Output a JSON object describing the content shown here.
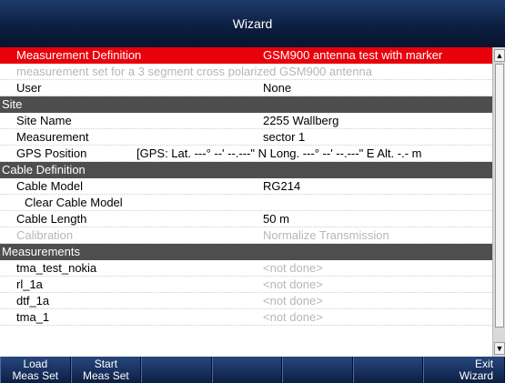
{
  "window": {
    "title": "Wizard"
  },
  "rows": {
    "measurement_definition": {
      "label": "Measurement Definition",
      "value": "GSM900 antenna test with marker"
    },
    "description": {
      "text": "measurement set for a 3 segment cross polarized GSM900 antenna"
    },
    "user": {
      "label": "User",
      "value": "None"
    },
    "site_header": {
      "label": "Site"
    },
    "site_name": {
      "label": "Site Name",
      "value": "2255 Wallberg"
    },
    "measurement": {
      "label": "Measurement",
      "value": "sector 1"
    },
    "gps_position": {
      "label": "GPS Position",
      "value": "[GPS: Lat.  ---° --' --.---\" N  Long.  ---° --' --.---\" E  Alt. -.- m"
    },
    "cable_header": {
      "label": "Cable Definition"
    },
    "cable_model": {
      "label": "Cable Model",
      "value": "RG214"
    },
    "clear_cable_model": {
      "label": "Clear Cable Model"
    },
    "cable_length": {
      "label": "Cable Length",
      "value": "50 m"
    },
    "calibration": {
      "label": "Calibration",
      "value": "Normalize Transmission"
    },
    "measurements_header": {
      "label": "Measurements"
    },
    "measurement_items": [
      {
        "label": "tma_test_nokia",
        "value": "<not done>"
      },
      {
        "label": "rl_1a",
        "value": "<not done>"
      },
      {
        "label": "dtf_1a",
        "value": "<not done>"
      },
      {
        "label": "tma_1",
        "value": "<not done>"
      }
    ]
  },
  "softkeys": {
    "load_label": "Load\nMeas Set",
    "start_label": "Start\nMeas Set",
    "exit_label": "Exit\nWizard"
  },
  "icons": {
    "scroll_up": "triangle-up",
    "scroll_down": "triangle-down"
  },
  "colors": {
    "selection": "#e8000b",
    "section_header": "#4e4e4e",
    "title_bar": "#0c1d3d",
    "disabled_text": "#b7b7b7"
  }
}
